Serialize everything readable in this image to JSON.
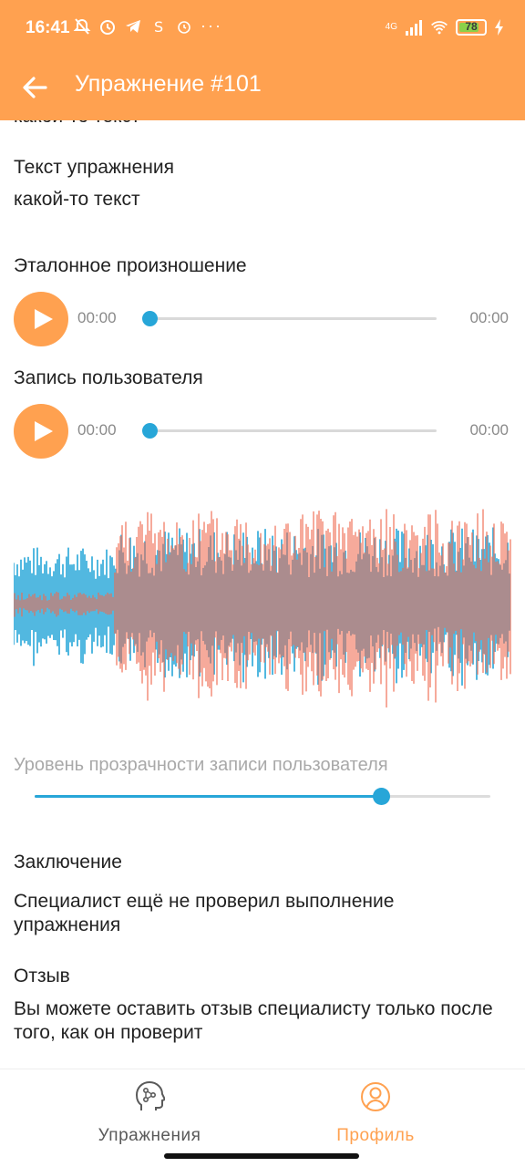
{
  "status_bar": {
    "time": "16:41",
    "network": "4G",
    "battery": "78",
    "more": "···"
  },
  "header": {
    "title": "Упражнение #101"
  },
  "content": {
    "previous_text_partial": "какой-то текст",
    "exercise_text_title": "Текст упражнения",
    "exercise_text": "какой-то текст",
    "reference_title": "Эталонное произношение",
    "reference_player": {
      "current": "00:00",
      "total": "00:00",
      "progress": 0
    },
    "user_recording_title": "Запись пользователя",
    "user_player": {
      "current": "00:00",
      "total": "00:00",
      "progress": 0
    },
    "opacity_label": "Уровень прозрачности записи пользователя",
    "opacity_value": 0.76,
    "conclusion_title": "Заключение",
    "conclusion_text": "Специалист ещё не проверил выполнение упражнения",
    "feedback_title": "Отзыв",
    "feedback_text": "Вы можете оставить отзыв специалисту только после того, как он проверит"
  },
  "bottom_nav": {
    "items": [
      {
        "label": "Упражнения",
        "icon": "head-brain-icon",
        "active": false
      },
      {
        "label": "Профиль",
        "icon": "profile-icon",
        "active": true
      }
    ]
  },
  "colors": {
    "accent": "#ffa150",
    "blue": "#27a6d8",
    "coral": "#f0755c",
    "nav_inactive": "#5a5a5a"
  }
}
